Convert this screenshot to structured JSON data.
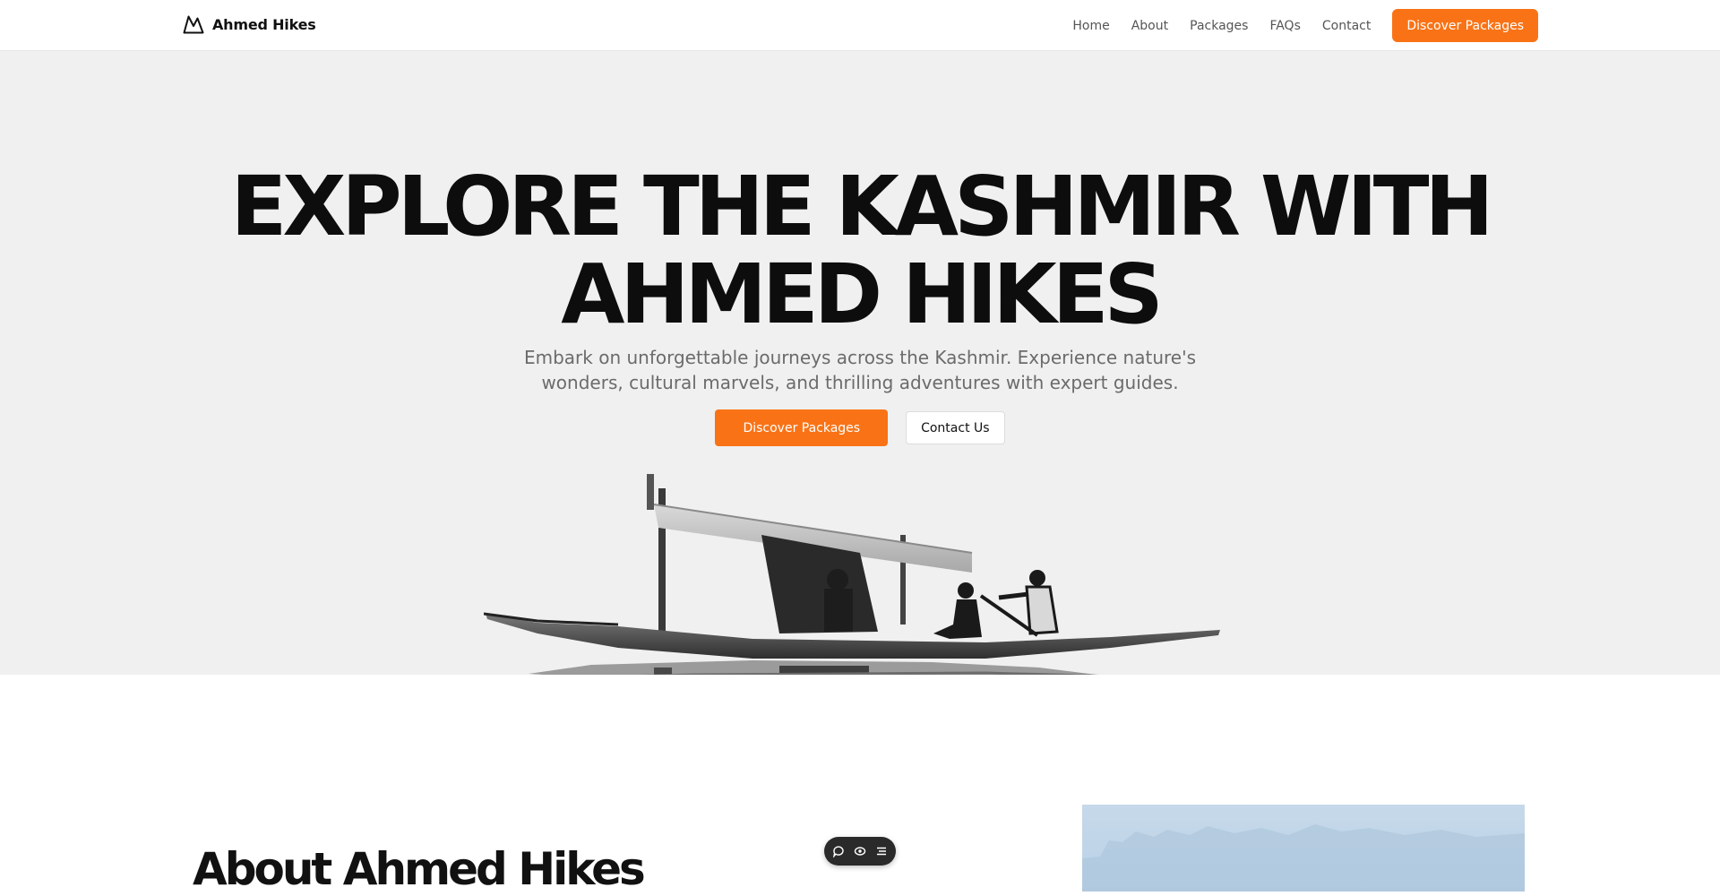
{
  "header": {
    "brand": {
      "name": "Ahmed Hikes",
      "icon": "mountain-icon"
    },
    "nav": [
      "Home",
      "About",
      "Packages",
      "FAQs",
      "Contact"
    ],
    "cta_label": "Discover Packages"
  },
  "hero": {
    "title_line1": "EXPLORE THE KASHMIR WITH",
    "title_line2": "AHMED HIKES",
    "subtitle": "Embark on unforgettable journeys across the Kashmir. Experience nature's wonders, cultural marvels, and thrilling adventures with expert guides.",
    "primary_label": "Discover Packages",
    "secondary_label": "Contact Us"
  },
  "about": {
    "title": "About Ahmed Hikes"
  },
  "toolbar": {
    "icons": [
      "comment-icon",
      "eye-icon",
      "list-icon"
    ]
  },
  "colors": {
    "accent": "#f97316",
    "hero_bg": "#f0f0f0",
    "text": "#0d0d0d",
    "muted": "#6b6b6b",
    "toolbar_bg": "#2a2a2a"
  }
}
